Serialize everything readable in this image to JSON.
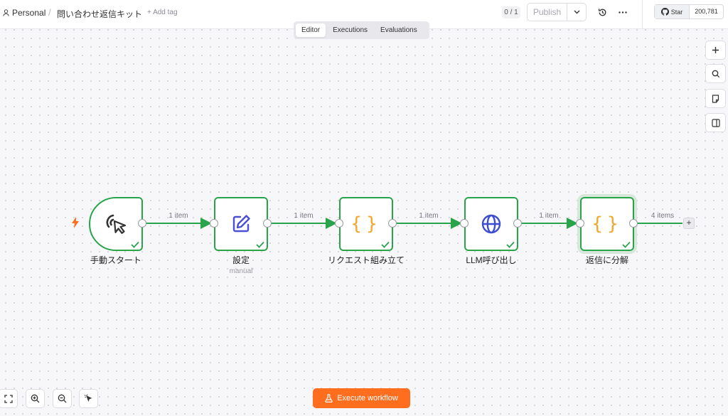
{
  "header": {
    "breadcrumb_personal": "Personal",
    "breadcrumb_separator": "/",
    "workflow_name": "問い合わせ返信キット",
    "add_tag": "+ Add tag",
    "version_badge": "0 / 1",
    "publish_label": "Publish",
    "github_star_label": "Star",
    "github_star_count": "200,781"
  },
  "tabs": [
    {
      "label": "Editor",
      "active": true
    },
    {
      "label": "Executions",
      "active": false
    },
    {
      "label": "Evaluations",
      "active": false
    }
  ],
  "workflow": {
    "nodes": [
      {
        "label": "手動スタート",
        "icon": "cursor-click-icon",
        "status": "success"
      },
      {
        "label": "設定",
        "sublabel": "manual",
        "icon": "edit-icon",
        "status": "success"
      },
      {
        "label": "リクエスト組み立て",
        "icon": "code-braces-icon",
        "glyph": "{}",
        "status": "success"
      },
      {
        "label": "LLM呼び出し",
        "icon": "globe-icon",
        "status": "success"
      },
      {
        "label": "返信に分解",
        "icon": "code-braces-icon",
        "glyph": "{}",
        "status": "success",
        "selected": true
      }
    ],
    "edges": [
      {
        "label": "1 item"
      },
      {
        "label": "1 item"
      },
      {
        "label": "1 item"
      },
      {
        "label": "1 item"
      },
      {
        "label": "4 items"
      }
    ]
  },
  "right_toolbar": [
    "add-icon",
    "search-icon",
    "sticky-note-icon",
    "panel-icon"
  ],
  "bottom_bar": {
    "tools": [
      "fit-view-icon",
      "zoom-in-icon",
      "zoom-out-icon",
      "tidy-up-icon"
    ],
    "execute_label": "Execute workflow"
  },
  "colors": {
    "success": "#2aa44a",
    "accent": "#ff6d1f",
    "code_icon": "#f0a82e",
    "edit_icon": "#4b4fd6",
    "globe_icon": "#3f4ed1"
  }
}
